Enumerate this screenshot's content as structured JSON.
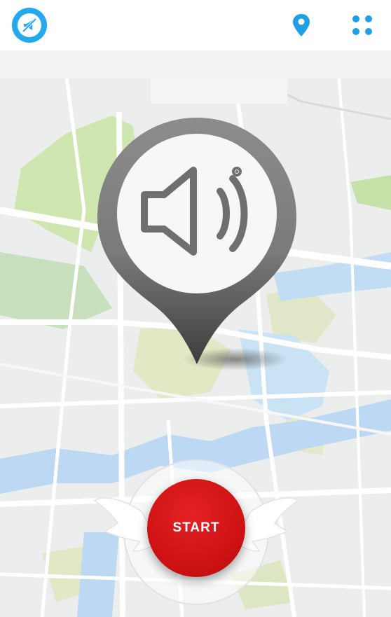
{
  "header": {
    "logo_icon": "megaphone-slash-icon",
    "location_icon": "map-pin-icon",
    "menu_icon": "grid-dots-icon",
    "accent_color": "#23a9ee"
  },
  "main": {
    "pin_icon": "speaker-icon",
    "start_label": "START",
    "start_color": "#d01315"
  }
}
